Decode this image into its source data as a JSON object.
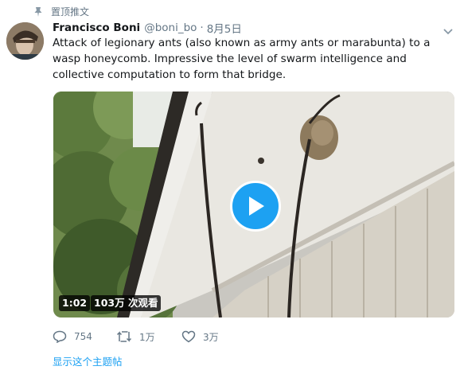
{
  "pinned": {
    "label": "置顶推文"
  },
  "tweet": {
    "display_name": "Francisco Boni",
    "handle": "@boni_bo",
    "separator": "·",
    "timestamp": "8月5日",
    "text": "Attack of legionary ants (also known as army ants or marabunta) to a wasp honeycomb. Impressive the level of swarm intelligence and collective computation to form that bridge."
  },
  "video": {
    "duration": "1:02",
    "views": "103万 次观看"
  },
  "actions": {
    "reply_count": "754",
    "retweet_count": "1万",
    "like_count": "3万"
  },
  "show_thread": "显示这个主题帖",
  "colors": {
    "accent": "#1da1f2",
    "muted": "#657786",
    "text": "#14171a"
  },
  "icons": [
    "pin-icon",
    "caret-down-icon",
    "play-icon",
    "reply-icon",
    "retweet-icon",
    "like-icon"
  ]
}
